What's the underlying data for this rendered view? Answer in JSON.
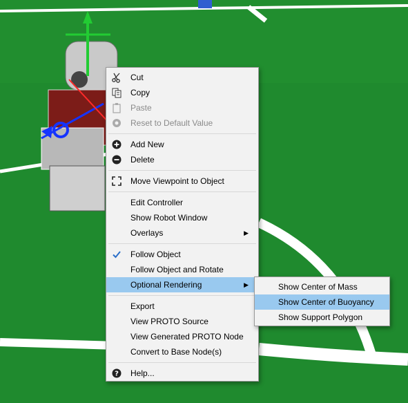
{
  "colors": {
    "menu_bg": "#f2f2f2",
    "highlight": "#99c9ef",
    "disabled_text": "#8a8a8a",
    "field_green": "#1f8a2e",
    "field_lines": "#ffffff"
  },
  "context_menu": {
    "cut": "Cut",
    "copy": "Copy",
    "paste": "Paste",
    "reset": "Reset to Default Value",
    "add_new": "Add New",
    "delete": "Delete",
    "move_viewpoint": "Move Viewpoint to Object",
    "edit_controller": "Edit Controller",
    "show_robot_window": "Show Robot Window",
    "overlays": "Overlays",
    "follow_object": "Follow Object",
    "follow_object_rotate": "Follow Object and Rotate",
    "optional_rendering": "Optional Rendering",
    "export": "Export",
    "view_proto_source": "View PROTO Source",
    "view_generated_proto": "View Generated PROTO Node",
    "convert_base_node": "Convert to Base Node(s)",
    "help": "Help..."
  },
  "submenu": {
    "center_of_mass": "Show Center of Mass",
    "center_of_buoyancy": "Show Center of Buoyancy",
    "support_polygon": "Show Support Polygon"
  },
  "icons": {
    "cut": "scissors-icon",
    "copy": "copy-icon",
    "paste": "paste-icon",
    "reset": "reset-icon",
    "add_new": "plus-circle-icon",
    "delete": "minus-circle-icon",
    "move_viewpoint": "focus-frame-icon",
    "follow_object": "checkmark-icon",
    "help": "question-circle-icon"
  }
}
